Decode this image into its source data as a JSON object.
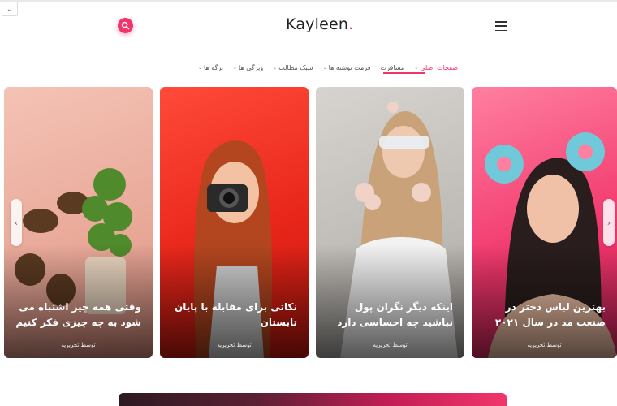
{
  "header": {
    "logo_text": "Kayleen",
    "logo_dot": ".",
    "search_icon": "search-icon",
    "menu_icon": "hamburger-menu-icon",
    "collapse_icon": "chevron-down-icon",
    "collapse_glyph": "⌄"
  },
  "nav": {
    "items": [
      {
        "label": "برگه ها",
        "has_dropdown": true,
        "active": false
      },
      {
        "label": "ویژگی ها",
        "has_dropdown": true,
        "active": false
      },
      {
        "label": "سبک مطالب",
        "has_dropdown": true,
        "active": false
      },
      {
        "label": "فرمت نوشته ها",
        "has_dropdown": true,
        "active": false
      },
      {
        "label": "مسافرت",
        "has_dropdown": false,
        "active": false
      },
      {
        "label": "صفحات اصلی",
        "has_dropdown": true,
        "active": true
      }
    ],
    "chevron_glyph": "⌄"
  },
  "slider": {
    "prev_glyph": "‹",
    "next_glyph": "›",
    "cards": [
      {
        "title": "وقتی همه چیز اشتباه می شود به چه چیزی فکر کنیم",
        "author": "توسط تحریریه"
      },
      {
        "title": "نکاتی برای مقابله با پایان تابستان",
        "author": "توسط تحریریه"
      },
      {
        "title": "اینکه دیگر نگران پول نباشید چه احساسی دارد",
        "author": "توسط تحریریه"
      },
      {
        "title": "بهترین لباس دختر در صنعت مد در سال ۲۰۲۱",
        "author": "توسط تحریریه"
      }
    ]
  },
  "colors": {
    "accent": "#f1356b",
    "text": "#222222"
  }
}
